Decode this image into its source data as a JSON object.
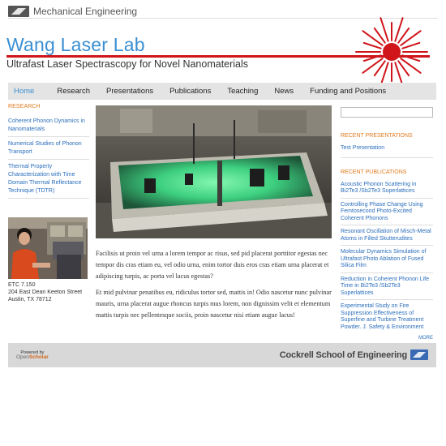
{
  "header": {
    "department": "Mechanical Engineering",
    "title": "Wang Laser Lab",
    "subtitle": "Ultrafast Laser Spectrascopy for Novel Nanomaterials"
  },
  "nav": {
    "items": [
      {
        "label": "Home",
        "active": true
      },
      {
        "label": "Research"
      },
      {
        "label": "Presentations"
      },
      {
        "label": "Publications"
      },
      {
        "label": "Teaching"
      },
      {
        "label": "News"
      },
      {
        "label": "Funding and Positions"
      }
    ]
  },
  "sidebar": {
    "heading": "RESEARCH",
    "items": [
      {
        "label": "Coherent Phonon Dynamics in Nanomaterials"
      },
      {
        "label": "Numerical Studies of Phonon Transport"
      },
      {
        "label": "Thermal Property Characterization with Time Domain Thermal Reflectance Technique (TDTR)"
      }
    ],
    "address": [
      "ETC 7.150",
      "204 East Dean Keeton Street",
      "Austin, TX 78712"
    ]
  },
  "main": {
    "paragraph1": "Facilisis ut proin vel urna a lorem tempor ac risus, sed pid placerat porttitor egestas nec tempor dis cras etiam eu, vel odio urna, enim tortor duis eros cras etiam urna placerat et adipiscing turpis, ac porta vel lacus egestas?",
    "paragraph2": "Et mid pulvinar penatibus eu, ridiculus tortor sed, mattis in! Odio nascetur nunc pulvinar mauris, urna placerat augue rhoncus turpis mus lorem, non dignissim velit et elementum mattis turpis nec pellentesque sociis, proin nascetur nisi etiam augue lacus!"
  },
  "right": {
    "presentations_heading": "RECENT PRESENTATIONS",
    "presentations": [
      {
        "label": "Test Presentation"
      }
    ],
    "publications_heading": "RECENT PUBLICATIONS",
    "publications": [
      {
        "label": "Acoustic Phonon Scattering in Bi2Te3 /Sb2Te3 Superlattices"
      },
      {
        "label": "Controlling Phase Change Using Femtosecond Photo-Excited Coherent Phonons"
      },
      {
        "label": "Resonant Oscillation of Misch-Metal Atoms in Filled Skutterudites"
      },
      {
        "label": "Molecular Dynamics Simulation of Ultrafast Photo Ablation of Fused Silica Film"
      },
      {
        "label": "Reduction in Coherent Phonon Life Time in Bi2Te3 /Sb2Te3 Superlattices"
      },
      {
        "label": "Experimental Study on Fire Suppression Effectiveness of Superfine and Turbine Treatment Powder. J. Safety & Environment"
      }
    ],
    "more_label": "MORE"
  },
  "footer": {
    "powered_by": "Powered by",
    "openscholar_prefix": "Open",
    "openscholar_suffix": "Scholar",
    "school": "Cockrell School of Engineering"
  },
  "colors": {
    "title_blue": "#3a8fd2",
    "accent_red": "#d0151b",
    "section_orange": "#e07a1f",
    "link_blue": "#2a6ebb"
  }
}
